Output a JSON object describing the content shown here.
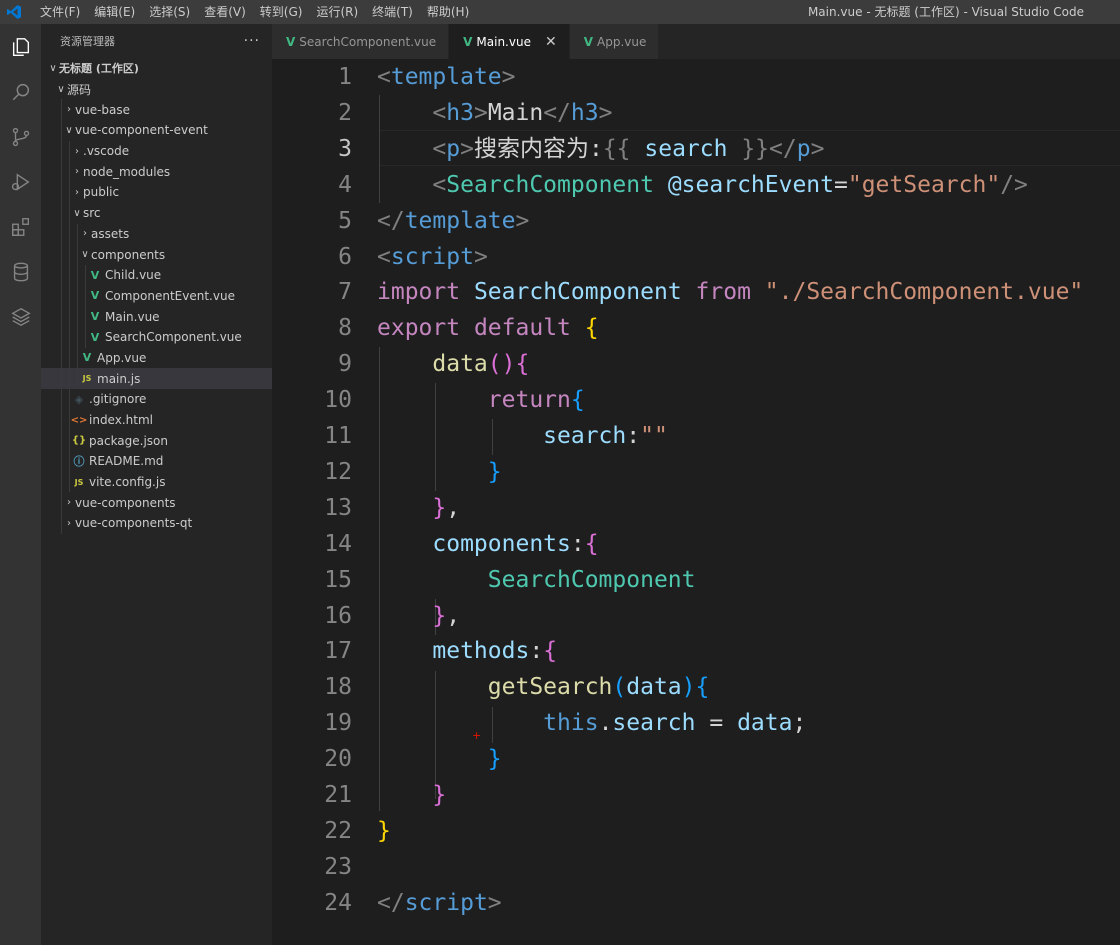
{
  "titlebar": {
    "menu": [
      "文件(F)",
      "编辑(E)",
      "选择(S)",
      "查看(V)",
      "转到(G)",
      "运行(R)",
      "终端(T)",
      "帮助(H)"
    ],
    "window_title": "Main.vue - 无标题 (工作区) - Visual Studio Code"
  },
  "activitybar": {
    "icons": [
      "explorer-icon",
      "search-icon",
      "source-control-icon",
      "run-debug-icon",
      "extensions-icon",
      "database-icon",
      "layers-icon"
    ]
  },
  "sidebar": {
    "title": "资源管理器",
    "more": "···",
    "workspace": "无标题 (工作区)",
    "tree": [
      {
        "label": "源码",
        "depth": 1,
        "twisty": "∨",
        "icon": ""
      },
      {
        "label": "vue-base",
        "depth": 2,
        "twisty": "›",
        "icon": ""
      },
      {
        "label": "vue-component-event",
        "depth": 2,
        "twisty": "∨",
        "icon": ""
      },
      {
        "label": ".vscode",
        "depth": 3,
        "twisty": "›",
        "icon": ""
      },
      {
        "label": "node_modules",
        "depth": 3,
        "twisty": "›",
        "icon": ""
      },
      {
        "label": "public",
        "depth": 3,
        "twisty": "›",
        "icon": ""
      },
      {
        "label": "src",
        "depth": 3,
        "twisty": "∨",
        "icon": ""
      },
      {
        "label": "assets",
        "depth": 4,
        "twisty": "›",
        "icon": ""
      },
      {
        "label": "components",
        "depth": 4,
        "twisty": "∨",
        "icon": ""
      },
      {
        "label": "Child.vue",
        "depth": 5,
        "twisty": "",
        "icon": "vue"
      },
      {
        "label": "ComponentEvent.vue",
        "depth": 5,
        "twisty": "",
        "icon": "vue"
      },
      {
        "label": "Main.vue",
        "depth": 5,
        "twisty": "",
        "icon": "vue"
      },
      {
        "label": "SearchComponent.vue",
        "depth": 5,
        "twisty": "",
        "icon": "vue"
      },
      {
        "label": "App.vue",
        "depth": 4,
        "twisty": "",
        "icon": "vue"
      },
      {
        "label": "main.js",
        "depth": 4,
        "twisty": "",
        "icon": "js",
        "selected": true
      },
      {
        "label": ".gitignore",
        "depth": 3,
        "twisty": "",
        "icon": "git"
      },
      {
        "label": "index.html",
        "depth": 3,
        "twisty": "",
        "icon": "html"
      },
      {
        "label": "package.json",
        "depth": 3,
        "twisty": "",
        "icon": "json"
      },
      {
        "label": "README.md",
        "depth": 3,
        "twisty": "",
        "icon": "info"
      },
      {
        "label": "vite.config.js",
        "depth": 3,
        "twisty": "",
        "icon": "js"
      },
      {
        "label": "vue-components",
        "depth": 2,
        "twisty": "›",
        "icon": ""
      },
      {
        "label": "vue-components-qt",
        "depth": 2,
        "twisty": "›",
        "icon": ""
      }
    ]
  },
  "tabs": [
    {
      "label": "SearchComponent.vue",
      "active": false
    },
    {
      "label": "Main.vue",
      "active": true,
      "close": "✕"
    },
    {
      "label": "App.vue",
      "active": false
    }
  ],
  "editor": {
    "current_line": 3,
    "breakpoint_glyph": "+",
    "lines": [
      [
        [
          "t-br",
          "<"
        ],
        [
          "t-tag",
          "template"
        ],
        [
          "t-br",
          ">"
        ]
      ],
      [
        [
          "",
          "    "
        ],
        [
          "t-br",
          "<"
        ],
        [
          "t-tag",
          "h3"
        ],
        [
          "t-br",
          ">"
        ],
        [
          "t-txt",
          "Main"
        ],
        [
          "t-br",
          "</"
        ],
        [
          "t-tag",
          "h3"
        ],
        [
          "t-br",
          ">"
        ]
      ],
      [
        [
          "",
          "    "
        ],
        [
          "t-br",
          "<"
        ],
        [
          "t-tag",
          "p"
        ],
        [
          "t-br",
          ">"
        ],
        [
          "t-txt",
          "搜索内容为:"
        ],
        [
          "t-brace",
          "{{"
        ],
        [
          "t-var",
          " search "
        ],
        [
          "t-brace",
          "}}"
        ],
        [
          "t-br",
          "</"
        ],
        [
          "t-tag",
          "p"
        ],
        [
          "t-br",
          ">"
        ]
      ],
      [
        [
          "",
          "    "
        ],
        [
          "t-br",
          "<"
        ],
        [
          "t-comp",
          "SearchComponent"
        ],
        [
          "t-txt",
          " "
        ],
        [
          "t-attr",
          "@searchEvent"
        ],
        [
          "t-txt",
          "="
        ],
        [
          "t-str",
          "\"getSearch\""
        ],
        [
          "t-br",
          "/>"
        ]
      ],
      [
        [
          "t-br",
          "</"
        ],
        [
          "t-tag",
          "template"
        ],
        [
          "t-br",
          ">"
        ]
      ],
      [
        [
          "t-br",
          "<"
        ],
        [
          "t-tag",
          "script"
        ],
        [
          "t-br",
          ">"
        ]
      ],
      [
        [
          "t-kw",
          "import"
        ],
        [
          "t-txt",
          " "
        ],
        [
          "t-var",
          "SearchComponent"
        ],
        [
          "t-txt",
          " "
        ],
        [
          "t-kw",
          "from"
        ],
        [
          "t-txt",
          " "
        ],
        [
          "t-str",
          "\"./SearchComponent.vue\""
        ]
      ],
      [
        [
          "t-kw",
          "export"
        ],
        [
          "t-txt",
          " "
        ],
        [
          "t-kw",
          "default"
        ],
        [
          "t-txt",
          " "
        ],
        [
          "b1",
          "{"
        ]
      ],
      [
        [
          "",
          "    "
        ],
        [
          "t-fn",
          "data"
        ],
        [
          "b2",
          "()"
        ],
        [
          "b2",
          "{"
        ]
      ],
      [
        [
          "",
          "        "
        ],
        [
          "t-kw",
          "return"
        ],
        [
          "b3",
          "{"
        ]
      ],
      [
        [
          "",
          "            "
        ],
        [
          "t-var",
          "search"
        ],
        [
          "t-txt",
          ":"
        ],
        [
          "t-str",
          "\"\""
        ]
      ],
      [
        [
          "",
          "        "
        ],
        [
          "b3",
          "}"
        ]
      ],
      [
        [
          "",
          "    "
        ],
        [
          "b2",
          "}"
        ],
        [
          "t-txt",
          ","
        ]
      ],
      [
        [
          "",
          "    "
        ],
        [
          "t-var",
          "components"
        ],
        [
          "t-txt",
          ":"
        ],
        [
          "b2",
          "{"
        ]
      ],
      [
        [
          "",
          "        "
        ],
        [
          "t-comp",
          "SearchComponent"
        ]
      ],
      [
        [
          "",
          "    "
        ],
        [
          "b2",
          "}"
        ],
        [
          "t-txt",
          ","
        ]
      ],
      [
        [
          "",
          "    "
        ],
        [
          "t-var",
          "methods"
        ],
        [
          "t-txt",
          ":"
        ],
        [
          "b2",
          "{"
        ]
      ],
      [
        [
          "",
          "        "
        ],
        [
          "t-fn",
          "getSearch"
        ],
        [
          "b3",
          "("
        ],
        [
          "t-var",
          "data"
        ],
        [
          "b3",
          ")"
        ],
        [
          "b3",
          "{"
        ]
      ],
      [
        [
          "",
          "            "
        ],
        [
          "t-kb",
          "this"
        ],
        [
          "t-txt",
          "."
        ],
        [
          "t-var",
          "search"
        ],
        [
          "t-txt",
          " = "
        ],
        [
          "t-var",
          "data"
        ],
        [
          "t-txt",
          ";"
        ]
      ],
      [
        [
          "",
          "        "
        ],
        [
          "b3",
          "}"
        ]
      ],
      [
        [
          "",
          "    "
        ],
        [
          "b2",
          "}"
        ]
      ],
      [
        [
          "b1",
          "}"
        ]
      ],
      [],
      [
        [
          "t-br",
          "</"
        ],
        [
          "t-tag",
          "script"
        ],
        [
          "t-br",
          ">"
        ]
      ]
    ]
  },
  "colors": {
    "titlebar": "#3c3c3c",
    "activitybar": "#333333",
    "sidebar": "#252526",
    "editor": "#1e1e1e",
    "vue_green": "#41b883",
    "vscode_blue": "#0078d4"
  }
}
